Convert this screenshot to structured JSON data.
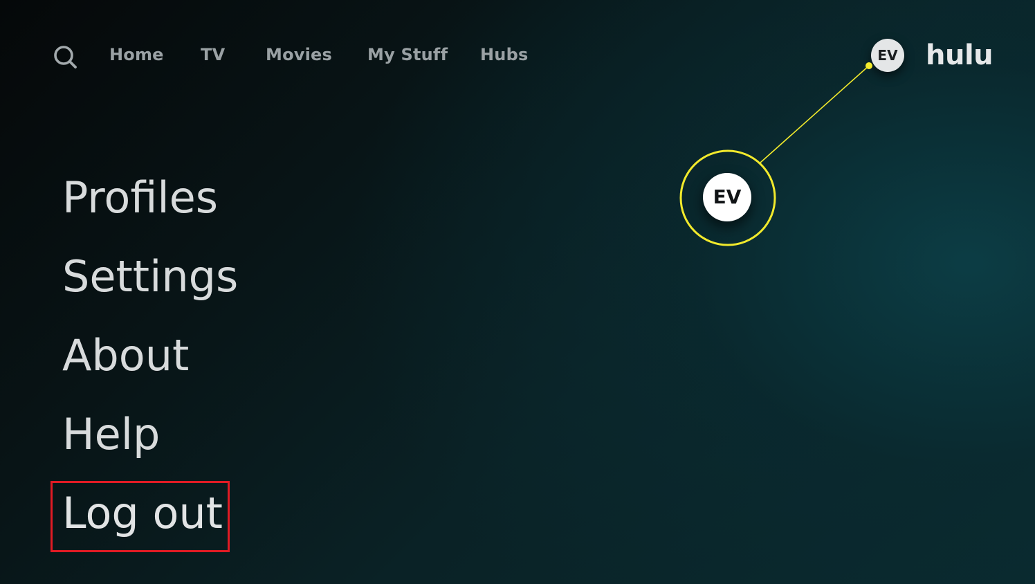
{
  "nav": {
    "search_icon": "search-icon",
    "items": [
      {
        "label": "Home"
      },
      {
        "label": "TV"
      },
      {
        "label": "Movies"
      },
      {
        "label": "My Stuff"
      },
      {
        "label": "Hubs"
      }
    ],
    "profile_initials": "EV",
    "brand": "hulu"
  },
  "callout": {
    "initials": "EV",
    "color": "#f2ea2c"
  },
  "menu": {
    "items": [
      {
        "label": "Profiles"
      },
      {
        "label": "Settings"
      },
      {
        "label": "About"
      },
      {
        "label": "Help"
      },
      {
        "label": "Log out"
      }
    ],
    "highlighted_item": "Log out",
    "highlight_color": "#e01b24"
  },
  "colors": {
    "background": "#0a2226",
    "nav_text": "#9aa1a4",
    "menu_text": "#d8dbdc"
  }
}
